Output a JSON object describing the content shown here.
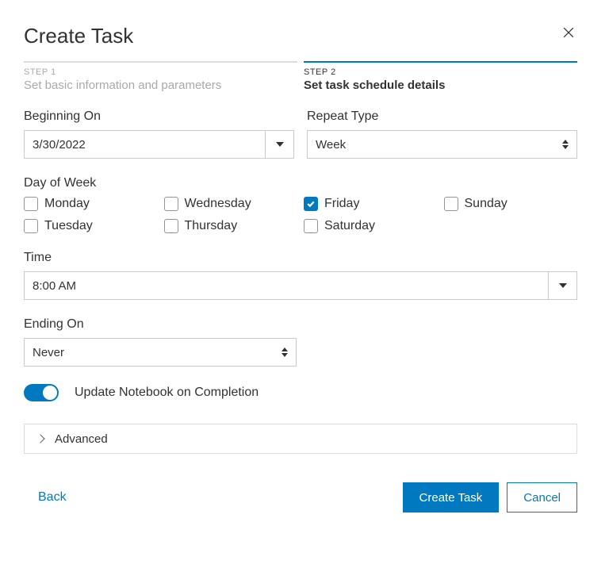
{
  "title": "Create Task",
  "steps": {
    "step1": {
      "label": "STEP 1",
      "desc": "Set basic information and parameters"
    },
    "step2": {
      "label": "STEP 2",
      "desc": "Set task schedule details"
    }
  },
  "fields": {
    "beginning_on": {
      "label": "Beginning On",
      "value": "3/30/2022"
    },
    "repeat_type": {
      "label": "Repeat Type",
      "value": "Week"
    },
    "day_of_week": {
      "label": "Day of Week"
    },
    "time": {
      "label": "Time",
      "value": "8:00 AM"
    },
    "ending_on": {
      "label": "Ending On",
      "value": "Never"
    }
  },
  "days": {
    "mon": "Monday",
    "tue": "Tuesday",
    "wed": "Wednesday",
    "thu": "Thursday",
    "fri": "Friday",
    "sat": "Saturday",
    "sun": "Sunday"
  },
  "toggle": {
    "label": "Update Notebook on Completion"
  },
  "advanced": {
    "label": "Advanced"
  },
  "footer": {
    "back": "Back",
    "create": "Create Task",
    "cancel": "Cancel"
  }
}
